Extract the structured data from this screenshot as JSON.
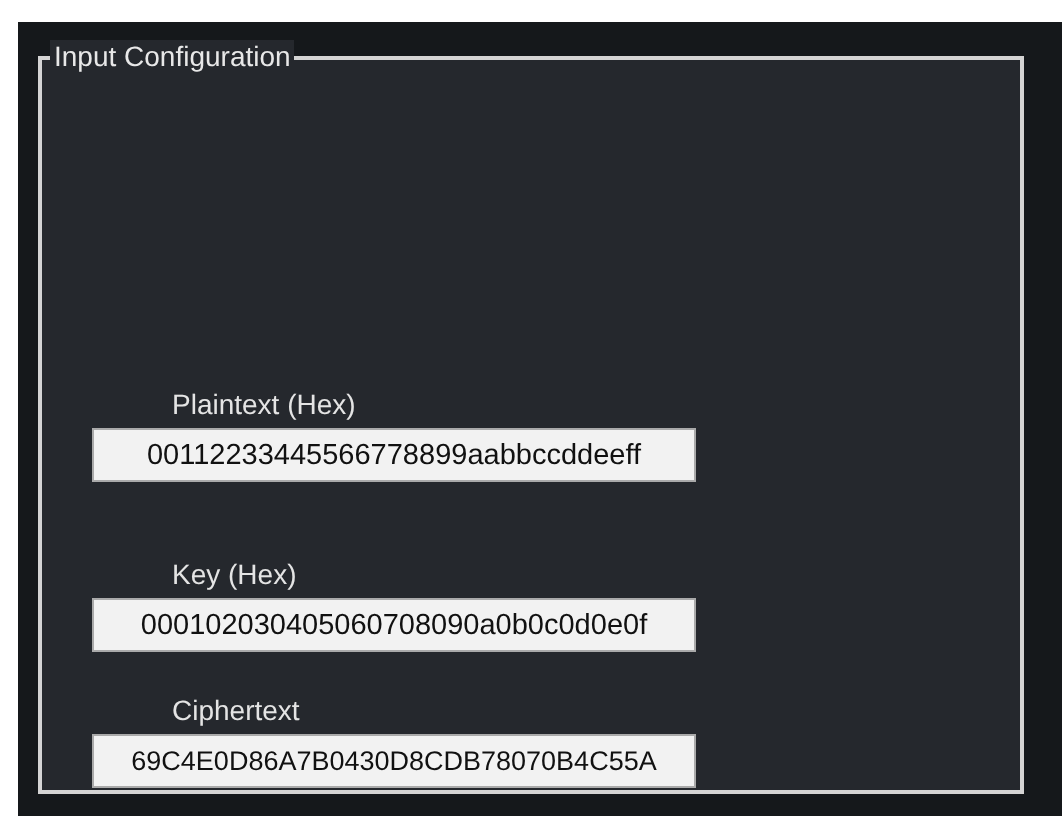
{
  "group": {
    "title": "Input Configuration"
  },
  "fields": [
    {
      "label": "Plaintext (Hex)",
      "value": "00112233445566778899aabbccddeeff"
    },
    {
      "label": "Key (Hex)",
      "value": "000102030405060708090a0b0c0d0e0f"
    },
    {
      "label": "Ciphertext",
      "value": "69C4E0D86A7B0430D8CDB78070B4C55A"
    }
  ]
}
